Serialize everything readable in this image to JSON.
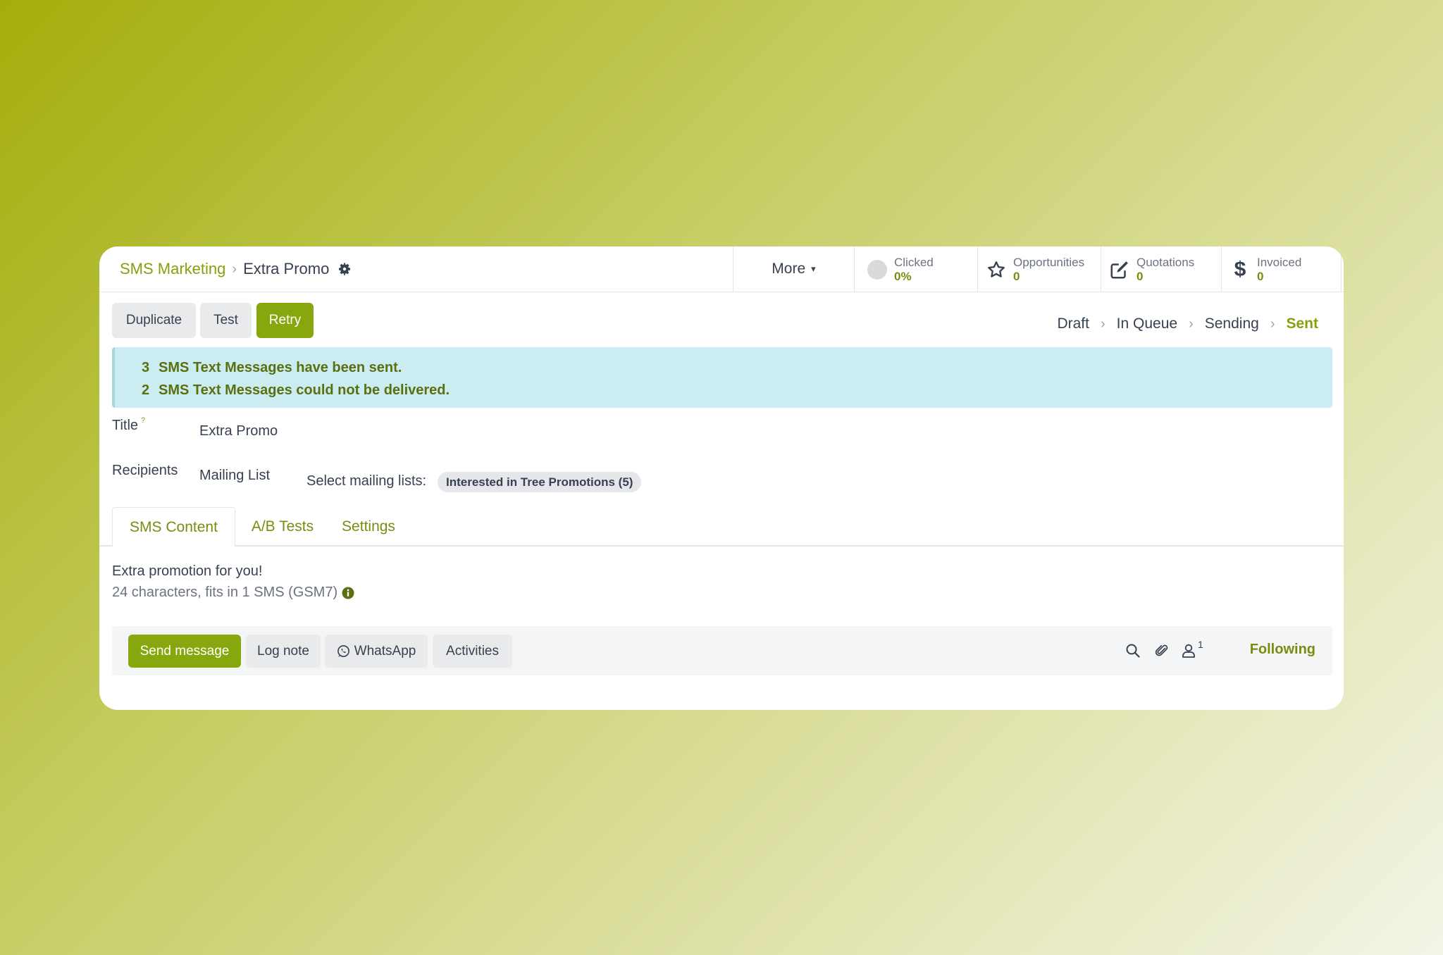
{
  "breadcrumb": {
    "parent": "SMS Marketing",
    "separator": "›",
    "current": "Extra Promo",
    "settings_icon": "gear-icon"
  },
  "more_button": {
    "label": "More",
    "caret": "▾"
  },
  "stats": {
    "clicked": {
      "label": "Clicked",
      "value": "0%",
      "icon": "circle-progress-icon"
    },
    "opportunities": {
      "label": "Opportunities",
      "value": "0",
      "icon": "star-icon"
    },
    "quotations": {
      "label": "Quotations",
      "value": "0",
      "icon": "edit-icon"
    },
    "invoiced": {
      "label": "Invoiced",
      "value": "0",
      "icon": "dollar-icon"
    }
  },
  "actions": {
    "duplicate": "Duplicate",
    "test": "Test",
    "retry": "Retry"
  },
  "status_bar": {
    "stages": [
      "Draft",
      "In Queue",
      "Sending",
      "Sent"
    ],
    "active": "Sent",
    "separator": "›"
  },
  "alert": {
    "lines": [
      {
        "count": "3",
        "text": "SMS Text Messages have been sent."
      },
      {
        "count": "2",
        "text": "SMS Text Messages could not be delivered."
      }
    ]
  },
  "fields": {
    "title_label": "Title",
    "title_help": "?",
    "title_value": "Extra Promo",
    "recipients_label": "Recipients",
    "recipients_value": "Mailing List",
    "mailing_lists_label": "Select mailing lists:",
    "mailing_list_tag": "Interested in Tree Promotions (5)"
  },
  "tabs": [
    {
      "label": "SMS Content",
      "active": true
    },
    {
      "label": "A/B Tests",
      "active": false
    },
    {
      "label": "Settings",
      "active": false
    }
  ],
  "content": {
    "body": "Extra promotion for you!",
    "char_info": "24 characters, fits in 1 SMS (GSM7)",
    "info_icon": "info-icon"
  },
  "chatter": {
    "send_message": "Send message",
    "log_note": "Log note",
    "whatsapp": "WhatsApp",
    "activities": "Activities",
    "follower_count": "1",
    "following": "Following"
  },
  "colors": {
    "accent": "#86a80e",
    "accent_text": "#8a9e0c",
    "alert_bg": "#cbecf1",
    "alert_text": "#5a7010"
  }
}
